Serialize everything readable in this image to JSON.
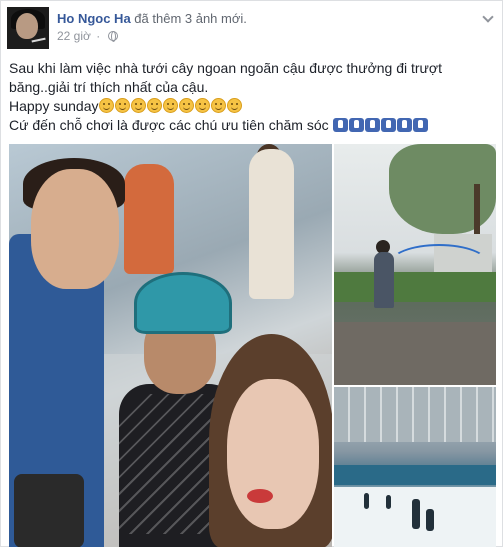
{
  "post": {
    "author": "Ho Ngoc Ha",
    "action": "đã thêm 3 ảnh mới.",
    "time": "22 giờ",
    "separator": "·",
    "lines": [
      "Sau khi làm việc nhà tưới cây ngoan ngoãn cậu được thưởng đi trượt",
      "băng..giải trí thích nhất của cậu.",
      "Happy sunday",
      "Cứ đến chỗ chơi là được các chú ưu tiên chăm sóc "
    ],
    "emoji_count": 9,
    "thumb_count": 6
  },
  "icons": {
    "avatar": "profile-avatar",
    "privacy": "globe-icon",
    "menu": "chevron-down-icon"
  },
  "colors": {
    "author": "#365899",
    "meta": "#90949c",
    "text": "#1d2129"
  }
}
